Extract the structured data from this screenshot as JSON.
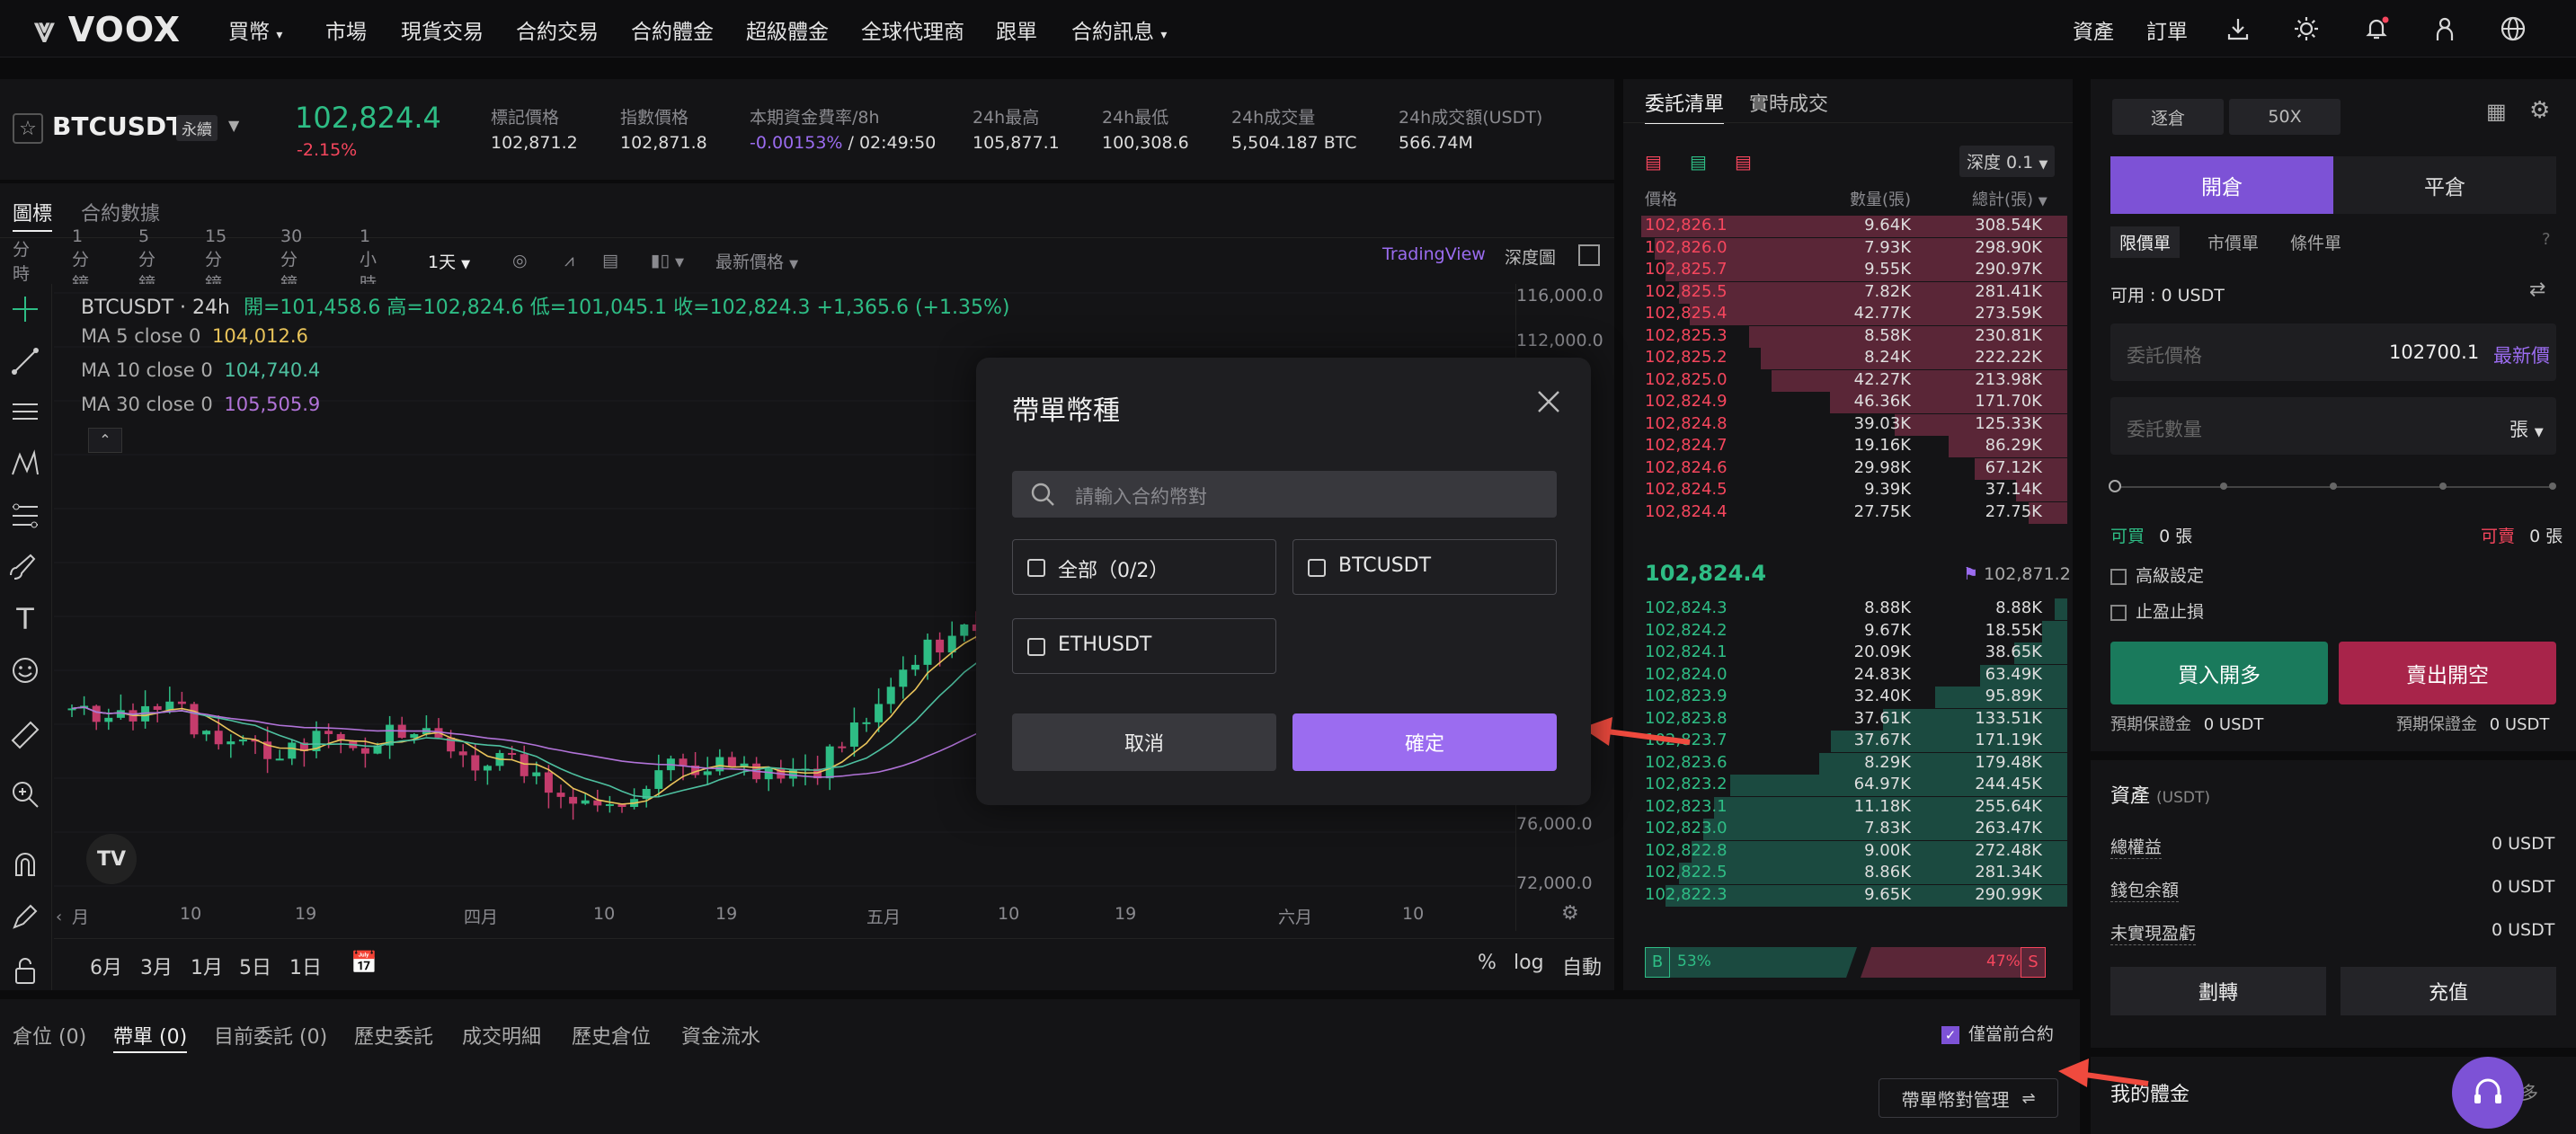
{
  "nav": {
    "logo": "VOOX",
    "items": [
      "買幣",
      "市場",
      "現貨交易",
      "合約交易",
      "合約體金",
      "超級體金",
      "全球代理商",
      "跟單",
      "合約訊息"
    ],
    "right": [
      "資產",
      "訂單"
    ]
  },
  "ticker": {
    "symbol": "BTCUSDT",
    "symbol_tag": "永續",
    "price": "102,824.4",
    "change": "-2.15%",
    "stats": [
      {
        "label": "標記價格",
        "value": "102,871.2"
      },
      {
        "label": "指數價格",
        "value": "102,871.8"
      },
      {
        "label": "本期資金費率/8h",
        "value": "-0.00153%",
        "value2": " / 02:49:50"
      },
      {
        "label": "24h最高",
        "value": "105,877.1"
      },
      {
        "label": "24h最低",
        "value": "100,308.6"
      },
      {
        "label": "24h成交量",
        "value": "5,504.187 BTC"
      },
      {
        "label": "24h成交額(USDT)",
        "value": "566.74M"
      }
    ]
  },
  "chart_header": {
    "tabs": [
      "圖標",
      "合約數據"
    ],
    "intervals": [
      "分時",
      "1分鐘",
      "5分鐘",
      "15分鐘",
      "30分鐘",
      "1小時",
      "1天"
    ],
    "price_type": "最新價格",
    "tradingview": "TradingView",
    "depth": "深度圖"
  },
  "chart": {
    "legend_title": "BTCUSDT · 24h",
    "ohlc": "開=101,458.6  高=102,824.6  低=101,045.1  收=102,824.3  +1,365.6 (+1.35%)",
    "ma": [
      {
        "label": "MA 5 close 0",
        "value": "104,012.6",
        "color": "#e8c35a"
      },
      {
        "label": "MA 10 close 0",
        "value": "104,740.4",
        "color": "#4ec0a0"
      },
      {
        "label": "MA 30 close 0",
        "value": "105,505.9",
        "color": "#b173d8"
      }
    ],
    "yticks": [
      "116,000.0",
      "112,000.0",
      "76,000.0",
      "72,000.0"
    ],
    "xticks": [
      "月",
      "10",
      "19",
      "四月",
      "10",
      "19",
      "五月",
      "10",
      "19",
      "六月",
      "10"
    ],
    "ranges": [
      "6月",
      "3月",
      "1月",
      "5日",
      "1日"
    ],
    "scale": [
      "%",
      "log",
      "自動"
    ]
  },
  "orderbook": {
    "tabs": [
      "委託清單",
      "實時成交"
    ],
    "depth_sel": "深度 0.1",
    "headers": [
      "價格",
      "數量(張)",
      "總計(張)"
    ],
    "asks": [
      [
        "102,826.1",
        "9.64K",
        "308.54K"
      ],
      [
        "102,826.0",
        "7.93K",
        "298.90K"
      ],
      [
        "102,825.7",
        "9.55K",
        "290.97K"
      ],
      [
        "102,825.5",
        "7.82K",
        "281.41K"
      ],
      [
        "102,825.4",
        "42.77K",
        "273.59K"
      ],
      [
        "102,825.3",
        "8.58K",
        "230.81K"
      ],
      [
        "102,825.2",
        "8.24K",
        "222.22K"
      ],
      [
        "102,825.0",
        "42.27K",
        "213.98K"
      ],
      [
        "102,824.9",
        "46.36K",
        "171.70K"
      ],
      [
        "102,824.8",
        "39.03K",
        "125.33K"
      ],
      [
        "102,824.7",
        "19.16K",
        "86.29K"
      ],
      [
        "102,824.6",
        "29.98K",
        "67.12K"
      ],
      [
        "102,824.5",
        "9.39K",
        "37.14K"
      ],
      [
        "102,824.4",
        "27.75K",
        "27.75K"
      ]
    ],
    "mid_price": "102,824.4",
    "mark_price": "102,871.2",
    "bids": [
      [
        "102,824.3",
        "8.88K",
        "8.88K"
      ],
      [
        "102,824.2",
        "9.67K",
        "18.55K"
      ],
      [
        "102,824.1",
        "20.09K",
        "38.65K"
      ],
      [
        "102,824.0",
        "24.83K",
        "63.49K"
      ],
      [
        "102,823.9",
        "32.40K",
        "95.89K"
      ],
      [
        "102,823.8",
        "37.61K",
        "133.51K"
      ],
      [
        "102,823.7",
        "37.67K",
        "171.19K"
      ],
      [
        "102,823.6",
        "8.29K",
        "179.48K"
      ],
      [
        "102,823.2",
        "64.97K",
        "244.45K"
      ],
      [
        "102,823.1",
        "11.18K",
        "255.64K"
      ],
      [
        "102,823.0",
        "7.83K",
        "263.47K"
      ],
      [
        "102,822.8",
        "9.00K",
        "272.48K"
      ],
      [
        "102,822.5",
        "8.86K",
        "281.34K"
      ],
      [
        "102,822.3",
        "9.65K",
        "290.99K"
      ]
    ],
    "buy_ratio": "53%",
    "sell_ratio": "47%",
    "buy_letter": "B",
    "sell_letter": "S"
  },
  "trade": {
    "margin_mode": "逐倉",
    "leverage": "50X",
    "open": "開倉",
    "close": "平倉",
    "order_types": [
      "限價單",
      "市價單",
      "條件單"
    ],
    "available": "可用 : 0 USDT",
    "price_placeholder": "委託價格",
    "price_value": "102700.1",
    "latest_price": "最新價",
    "qty_placeholder": "委託數量",
    "qty_unit": "張",
    "can_buy": "可買",
    "can_buy_val": "0 張",
    "can_sell": "可賣",
    "can_sell_val": "0 張",
    "advanced": "高級設定",
    "tpsl": "止盈止損",
    "buy_btn": "買入開多",
    "sell_btn": "賣出開空",
    "margin_label": "預期保證金",
    "margin_val": "0 USDT",
    "assets_title": "資產",
    "assets_unit": "(USDT)",
    "asset_rows": [
      {
        "label": "總權益",
        "value": "0 USDT"
      },
      {
        "label": "錢包余額",
        "value": "0 USDT"
      },
      {
        "label": "未實現盈虧",
        "value": "0 USDT"
      }
    ],
    "transfer": "劃轉",
    "deposit": "充值",
    "my_bonus": "我的體金",
    "more": "多"
  },
  "bottom": {
    "tabs": [
      "倉位 (0)",
      "帶單 (0)",
      "目前委託 (0)",
      "歷史委託",
      "成交明細",
      "歷史倉位",
      "資金流水"
    ],
    "current_only": "僅當前合約",
    "manage_btn": "帶單幣對管理"
  },
  "modal": {
    "title": "帶單幣種",
    "search_placeholder": "請輸入合約幣對",
    "options": [
      "全部（0/2）",
      "BTCUSDT",
      "ETHUSDT"
    ],
    "cancel": "取消",
    "confirm": "確定"
  },
  "colors": {
    "accent": "#9b6cf0",
    "buy": "#2ebd85",
    "sell": "#f6465d",
    "ask_bg": "#5a2637",
    "bid_bg": "#1b4a40"
  }
}
